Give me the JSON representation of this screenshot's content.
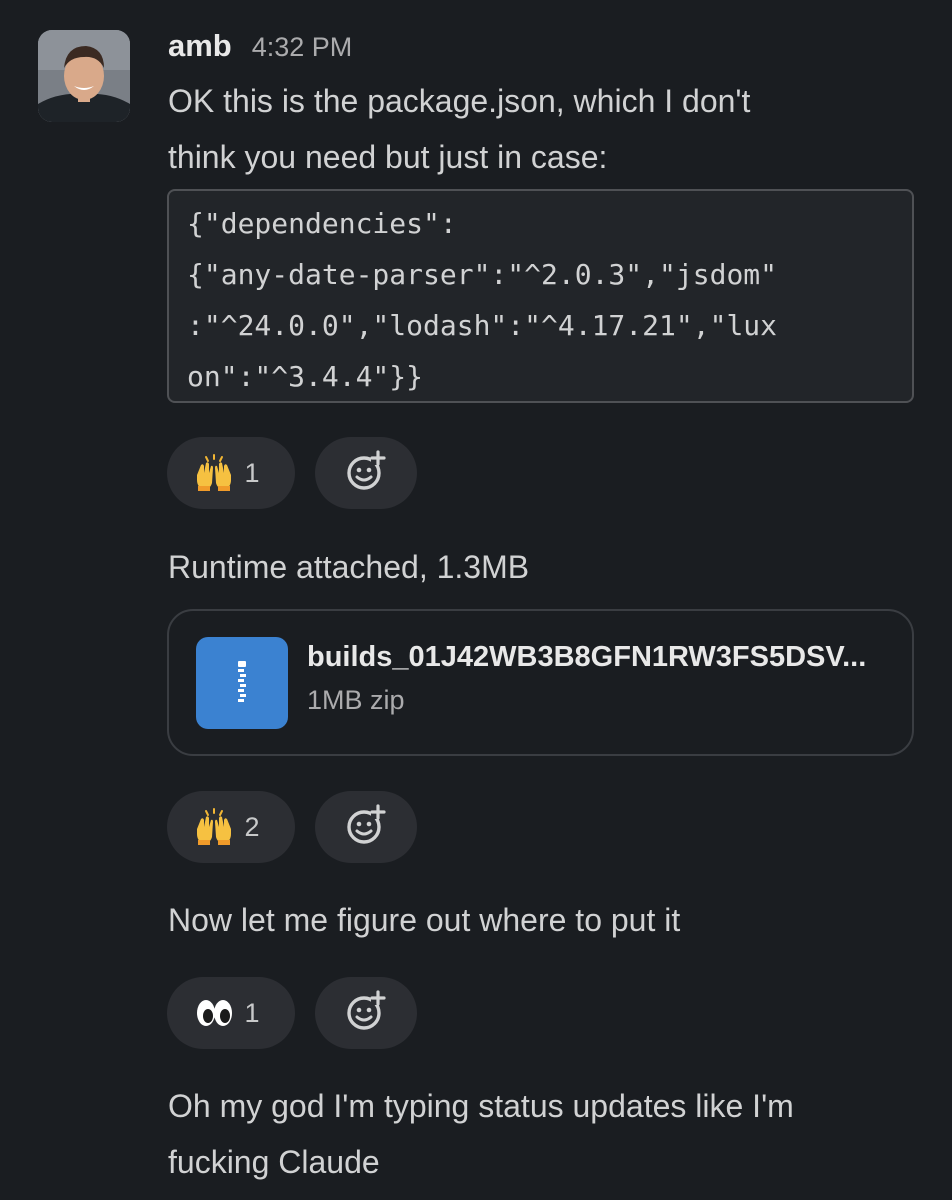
{
  "message": {
    "author": "amb",
    "time": "4:32 PM",
    "text_line1": "OK this is the package.json, which I don't",
    "text_line2": "think you need but just in case:",
    "code_lines": [
      "{\"dependencies\":",
      "{\"any-date-parser\":\"^2.0.3\",\"jsdom\"",
      ":\"^24.0.0\",\"lodash\":\"^4.17.21\",\"lux",
      "on\":\"^3.4.4\"}}"
    ],
    "reactions": [
      {
        "emoji": "raising-hands",
        "count": "1"
      }
    ]
  },
  "attachment_message": {
    "text": "Runtime attached, 1.3MB",
    "file": {
      "name": "builds_01J42WB3B8GFN1RW3FS5DSV...",
      "meta": "1MB zip",
      "icon": "zip-file-icon",
      "icon_color": "#3b82d1"
    },
    "reactions": [
      {
        "emoji": "raising-hands",
        "count": "2"
      }
    ]
  },
  "message3": {
    "text": "Now let me figure out where to put it",
    "reactions": [
      {
        "emoji": "eyes",
        "count": "1"
      }
    ]
  },
  "message4": {
    "text_line1": "Oh my god I'm typing status updates like I'm",
    "text_line2": "fucking Claude"
  },
  "colors": {
    "background": "#1a1d21",
    "pill": "#2c2e33",
    "text": "#d1d2d3"
  }
}
